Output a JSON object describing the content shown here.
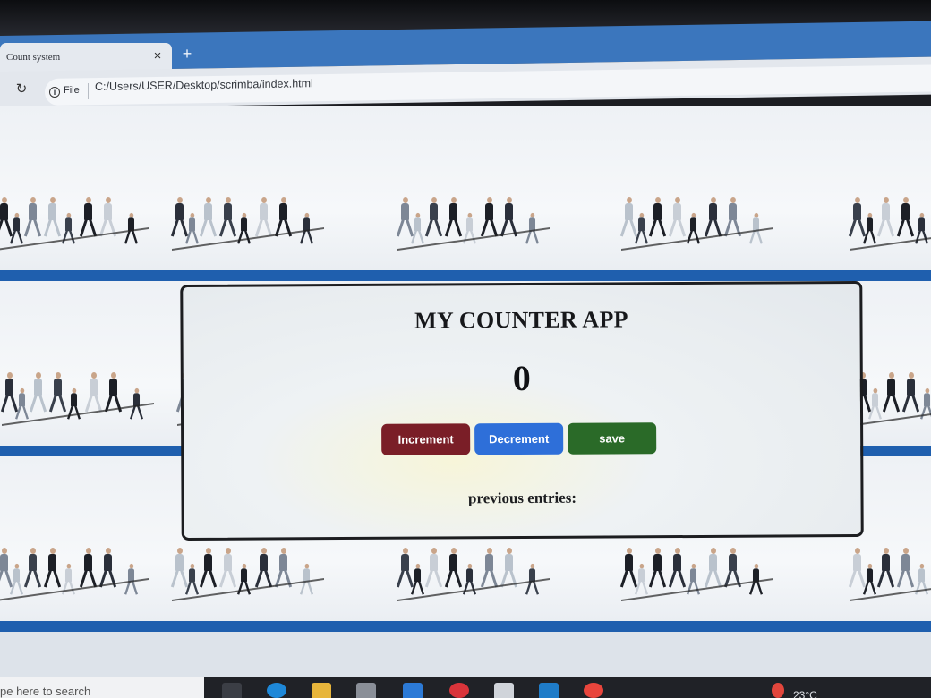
{
  "browser": {
    "tab_title": "Count system",
    "tab_close": "×",
    "new_tab": "+",
    "reload_icon": "↻",
    "site_info_label": "File",
    "url": "C:/Users/USER/Desktop/scrimba/index.html"
  },
  "app": {
    "title": "MY COUNTER APP",
    "count": "0",
    "buttons": {
      "increment": "Increment",
      "decrement": "Decrement",
      "save": "save"
    },
    "previous_label": "previous entries:",
    "colors": {
      "increment": "#7a1e27",
      "decrement": "#2e6fd9",
      "save": "#2a6a28"
    }
  },
  "taskbar": {
    "search_placeholder": "pe here to search",
    "weather": "23°C"
  }
}
